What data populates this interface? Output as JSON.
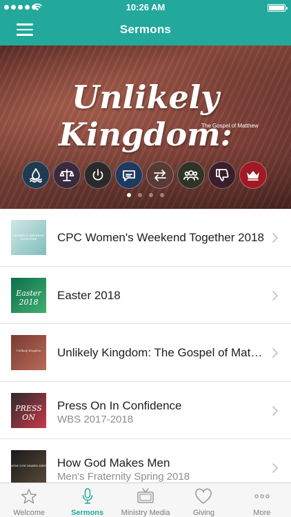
{
  "status_bar": {
    "time": "10:26 AM"
  },
  "nav": {
    "title": "Sermons"
  },
  "banner": {
    "title": "Unlikely Kingdom:",
    "subtitle": "The Gospel of Matthew",
    "icons": [
      "water-drop-icon",
      "scales-icon",
      "power-icon",
      "speech-bubble-icon",
      "exchange-arrows-icon",
      "people-icon",
      "thumbs-down-icon",
      "crown-icon"
    ],
    "icon_colors": [
      "#1f3a52",
      "#3a2a3e",
      "#2a2a2a",
      "#1f3a60",
      "#5a3a34",
      "#2f3328",
      "#3a1f2a",
      "#a01a24"
    ],
    "page_count": 4,
    "active_page": 1
  },
  "list": {
    "items": [
      {
        "title": "CPC Women's Weekend Together 2018",
        "subtitle": "",
        "thumb_text": "WOMEN'S WEEKEND TOGETHER",
        "thumb_colors": [
          "#cfe7e6",
          "#7fbdbb"
        ]
      },
      {
        "title": "Easter 2018",
        "subtitle": "",
        "thumb_text": "Easter 2018",
        "thumb_colors": [
          "#0f6d4a",
          "#3fb070"
        ]
      },
      {
        "title": "Unlikely Kingdom: The Gospel of Matthew",
        "subtitle": "",
        "thumb_text": "Unlikely Kingdom",
        "thumb_colors": [
          "#7a3a32",
          "#b86b58"
        ]
      },
      {
        "title": "Press On In Confidence",
        "subtitle": "WBS 2017-2018",
        "thumb_text": "PRESS ON",
        "thumb_colors": [
          "#2a2a2a",
          "#c83a4a"
        ]
      },
      {
        "title": "How God Makes Men",
        "subtitle": "Men's Fraternity Spring 2018",
        "thumb_text": "HOW GOD MAKES MEN",
        "thumb_colors": [
          "#1a1a1a",
          "#5a4a3a"
        ]
      }
    ]
  },
  "tabbar": {
    "tabs": [
      {
        "label": "Welcome",
        "icon": "star-icon"
      },
      {
        "label": "Sermons",
        "icon": "microphone-icon",
        "active": true
      },
      {
        "label": "Ministry Media",
        "icon": "tv-icon"
      },
      {
        "label": "Giving",
        "icon": "heart-icon"
      },
      {
        "label": "More",
        "icon": "more-dots-icon"
      }
    ],
    "active_color": "#22a99b"
  }
}
